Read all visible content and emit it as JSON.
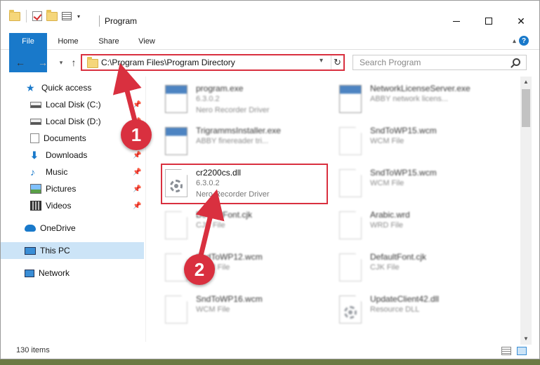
{
  "window": {
    "title": "Program"
  },
  "ribbon": {
    "tabs": [
      {
        "label": "File"
      },
      {
        "label": "Home"
      },
      {
        "label": "Share"
      },
      {
        "label": "View"
      }
    ]
  },
  "address": {
    "path": "C:\\Program Files\\Program Directory"
  },
  "search": {
    "placeholder": "Search Program"
  },
  "sidebar": {
    "items": [
      {
        "label": "Quick access",
        "icon": "star-icon"
      },
      {
        "label": "Local Disk (C:)",
        "icon": "drive-icon",
        "pinned": true
      },
      {
        "label": "Local Disk (D:)",
        "icon": "drive-icon",
        "pinned": true
      },
      {
        "label": "Documents",
        "icon": "documents-icon",
        "pinned": true
      },
      {
        "label": "Downloads",
        "icon": "downloads-icon",
        "pinned": true
      },
      {
        "label": "Music",
        "icon": "music-icon",
        "pinned": true
      },
      {
        "label": "Pictures",
        "icon": "pictures-icon",
        "pinned": true
      },
      {
        "label": "Videos",
        "icon": "videos-icon",
        "pinned": true
      },
      {
        "label": "OneDrive",
        "icon": "onedrive-icon"
      },
      {
        "label": "This PC",
        "icon": "computer-icon",
        "selected": true
      },
      {
        "label": "Network",
        "icon": "network-icon"
      }
    ]
  },
  "files": [
    {
      "name": "program.exe",
      "line2": "6.3.0.2",
      "line3": "Nero Recorder Driver",
      "icon": "program-exe-icon"
    },
    {
      "name": "NetworkLicenseServer.exe",
      "line2": "ABBY network licens...",
      "line3": "",
      "icon": "exe-icon"
    },
    {
      "name": "TrigrammsInstaller.exe",
      "line2": "ABBY finereader tri...",
      "line3": "",
      "icon": "exe-icon"
    },
    {
      "name": "SndToWP15.wcm",
      "line2": "WCM File",
      "line3": "",
      "icon": "document-icon"
    },
    {
      "name": "cr2200cs.dll",
      "line2": "6.3.0.2",
      "line3": "Nero Recorder Driver",
      "icon": "dll-gear-icon"
    },
    {
      "name": "SndToWP15.wcm",
      "line2": "WCM File",
      "line3": "",
      "icon": "document-icon"
    },
    {
      "name": "DefaultFont.cjk",
      "line2": "CJK File",
      "line3": "",
      "icon": "document-icon"
    },
    {
      "name": "Arabic.wrd",
      "line2": "WRD File",
      "line3": "",
      "icon": "document-icon"
    },
    {
      "name": "SndToWP12.wcm",
      "line2": "WCM File",
      "line3": "",
      "icon": "document-icon"
    },
    {
      "name": "DefaultFont.cjk",
      "line2": "CJK File",
      "line3": "",
      "icon": "document-icon"
    },
    {
      "name": "SndToWP16.wcm",
      "line2": "WCM File",
      "line3": "",
      "icon": "document-icon"
    },
    {
      "name": "UpdateClient42.dll",
      "line2": "Resource DLL",
      "line3": "",
      "icon": "dll-gear-icon"
    }
  ],
  "callouts": [
    {
      "label": "1"
    },
    {
      "label": "2"
    }
  ],
  "status": {
    "item_count": "130 items"
  },
  "colors": {
    "accent": "#1979ca",
    "highlight": "#d9303f",
    "selected_bg": "#cce4f7"
  }
}
